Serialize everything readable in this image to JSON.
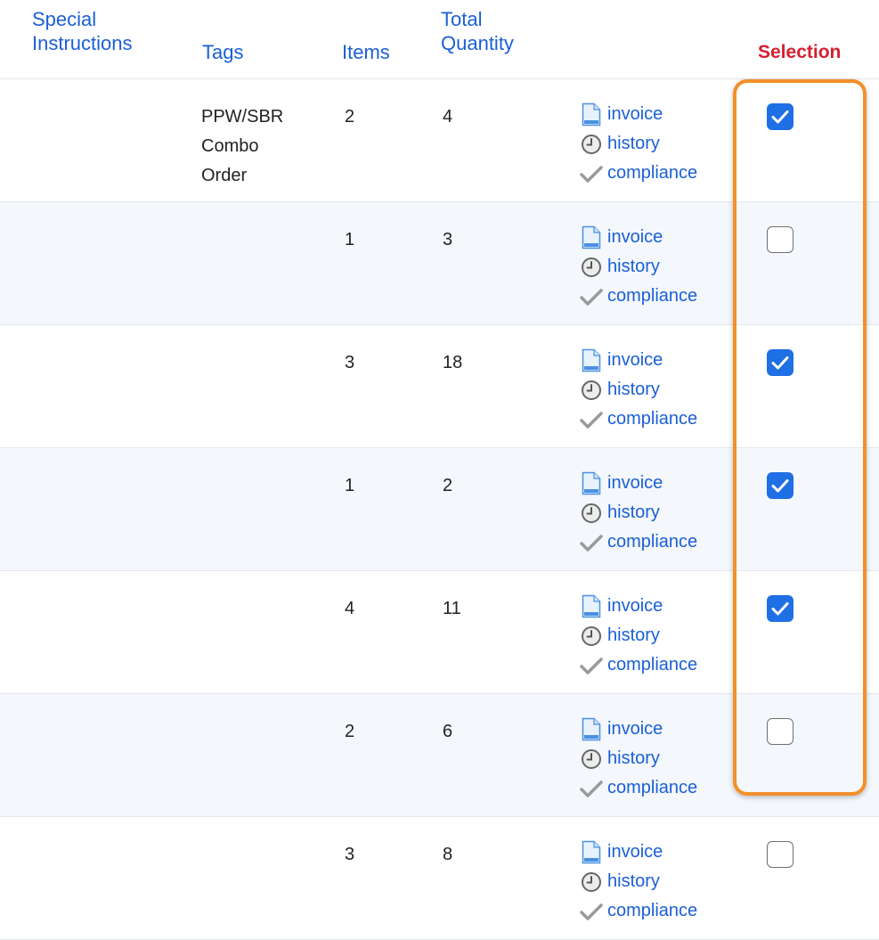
{
  "header": {
    "special_instructions_line1": "Special",
    "special_instructions_line2": "Instructions",
    "tags": "Tags",
    "items": "Items",
    "total_quantity_line1": "Total",
    "total_quantity_line2": "Quantity",
    "selection": "Selection"
  },
  "link_labels": {
    "invoice": "invoice",
    "history": "history",
    "compliance": "compliance"
  },
  "icons": {
    "invoice": "document-icon",
    "history": "clock-icon",
    "compliance": "checkmark-icon"
  },
  "colors": {
    "link": "#1a5fd6",
    "selection_header": "#d42030",
    "checkbox_checked": "#1f6fe5",
    "highlight_border": "#f2902a",
    "alt_row": "#f4f7fb"
  },
  "rows": [
    {
      "tags_line1": "PPW/SBR",
      "tags_line2": "Combo",
      "tags_line3": "Order",
      "items": "2",
      "total_quantity": "4",
      "selected": true
    },
    {
      "tags_line1": "",
      "tags_line2": "",
      "tags_line3": "",
      "items": "1",
      "total_quantity": "3",
      "selected": false
    },
    {
      "tags_line1": "",
      "tags_line2": "",
      "tags_line3": "",
      "items": "3",
      "total_quantity": "18",
      "selected": true
    },
    {
      "tags_line1": "",
      "tags_line2": "",
      "tags_line3": "",
      "items": "1",
      "total_quantity": "2",
      "selected": true
    },
    {
      "tags_line1": "",
      "tags_line2": "",
      "tags_line3": "",
      "items": "4",
      "total_quantity": "11",
      "selected": true
    },
    {
      "tags_line1": "",
      "tags_line2": "",
      "tags_line3": "",
      "items": "2",
      "total_quantity": "6",
      "selected": false
    },
    {
      "tags_line1": "",
      "tags_line2": "",
      "tags_line3": "",
      "items": "3",
      "total_quantity": "8",
      "selected": false
    }
  ]
}
